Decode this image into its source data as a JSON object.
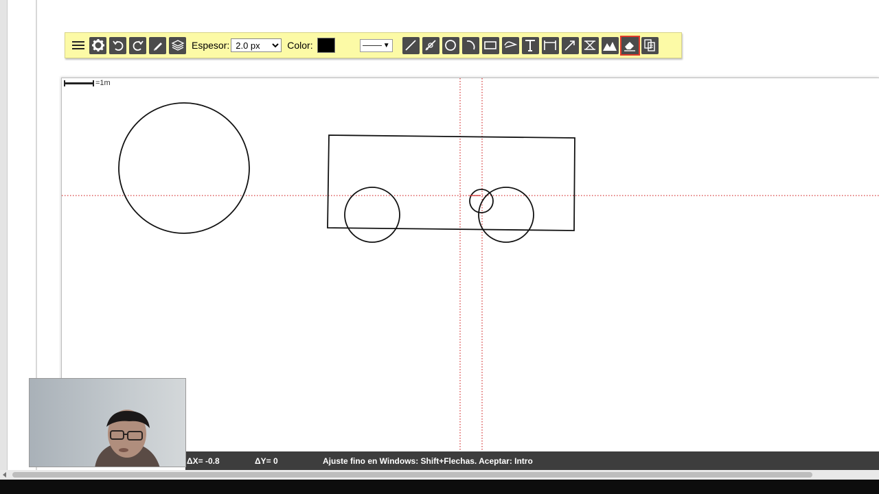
{
  "toolbar": {
    "thickness_label": "Espesor:",
    "thickness_value": "2.0 px",
    "color_label": "Color:",
    "color_value": "#000000",
    "accent_bg": "#fcfaa6",
    "tools": [
      {
        "name": "menu-icon"
      },
      {
        "name": "gear-icon"
      },
      {
        "name": "undo-icon"
      },
      {
        "name": "redo-icon"
      },
      {
        "name": "pencil-icon"
      },
      {
        "name": "layers-icon"
      },
      {
        "name": "line-icon"
      },
      {
        "name": "polyline-icon"
      },
      {
        "name": "circle-icon"
      },
      {
        "name": "arc-icon"
      },
      {
        "name": "rectangle-icon"
      },
      {
        "name": "curve-icon"
      },
      {
        "name": "text-icon"
      },
      {
        "name": "dimension-icon"
      },
      {
        "name": "arrow-icon"
      },
      {
        "name": "transform-icon"
      },
      {
        "name": "image-icon"
      },
      {
        "name": "eraser-icon",
        "active": true
      },
      {
        "name": "copy-icon"
      }
    ]
  },
  "canvas": {
    "scale_label": "=1m"
  },
  "status": {
    "delta_x": "ΔX= -0.8",
    "delta_y": "ΔY= 0",
    "hint": "Ajuste fino en Windows: Shift+Flechas. Aceptar: Intro"
  }
}
